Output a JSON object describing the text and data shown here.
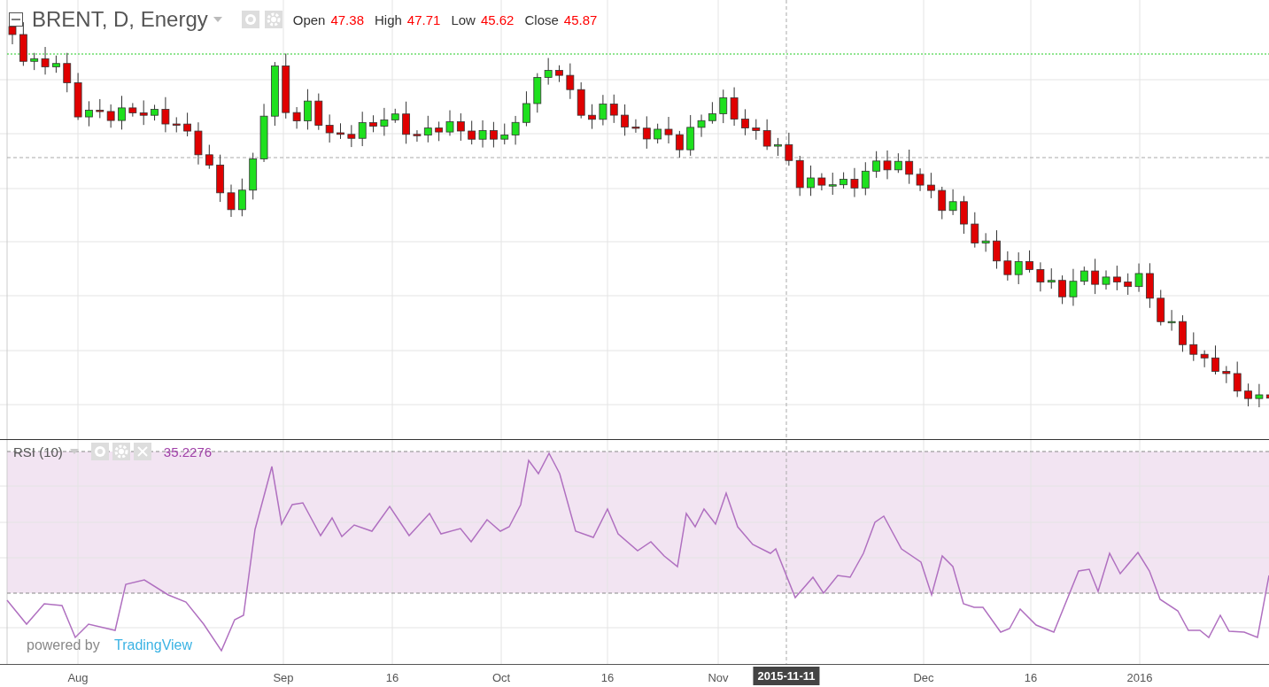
{
  "legend": {
    "symbol": "BRENT, D, Energy",
    "ohlc": [
      {
        "label": "Open",
        "value": "47.38"
      },
      {
        "label": "High",
        "value": "47.71"
      },
      {
        "label": "Low",
        "value": "45.62"
      },
      {
        "label": "Close",
        "value": "45.87"
      }
    ]
  },
  "indicator": {
    "label": "RSI (10)",
    "value": "35.2276"
  },
  "branding": {
    "prefix": "powered by",
    "name": "TradingView"
  },
  "time_axis": {
    "labels": [
      "Aug",
      "Sep",
      "16",
      "Oct",
      "16",
      "Nov",
      "Dec",
      "16",
      "2016"
    ],
    "crosshair_label": "2015-11-11"
  }
}
